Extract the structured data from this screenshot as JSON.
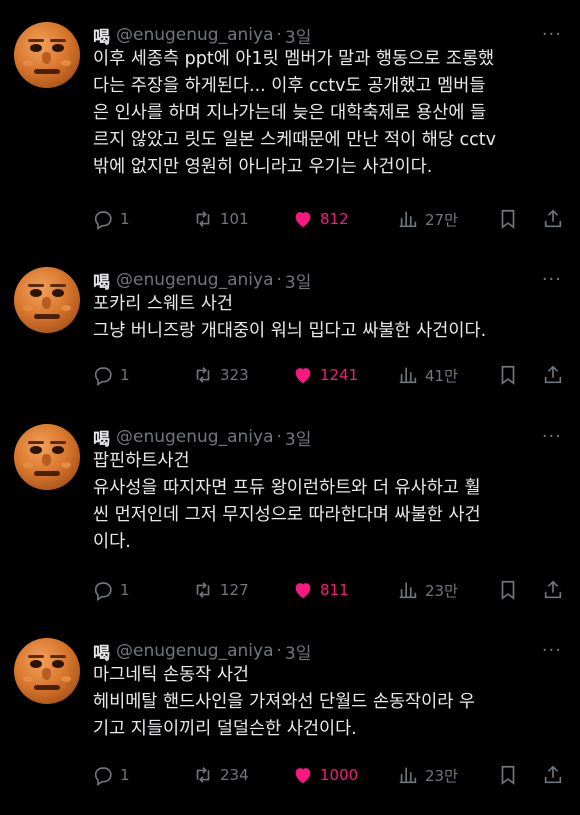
{
  "colors": {
    "background": "#000000",
    "text": "#e7e9ea",
    "muted": "#71767b",
    "like": "#f91880"
  },
  "icons": {
    "more": "more-icon",
    "reply": "reply-icon",
    "retweet": "retweet-icon",
    "like": "heart-filled-icon",
    "views": "views-icon",
    "bookmark": "bookmark-icon",
    "share": "share-icon"
  },
  "more_glyph": "···",
  "dot": "·",
  "tweets": [
    {
      "name": "喝",
      "handle": "@enugenug_aniya",
      "time": "3일",
      "lines": [
        "이후 세종측 ppt에 아1릿 멤버가 말과 행동으로 조롱했",
        "다는 주장을 하게된다... 이후 cctv도 공개했고 멤버들",
        "은 인사를 하며 지나가는데 늦은 대학축제로 용산에 들",
        "르지 않았고 릿도 일본 스케때문에 만난 적이 해당 cctv",
        "밖에 없지만 영원히 아니라고 우기는 사건이다."
      ],
      "replies": "1",
      "retweets": "101",
      "likes": "812",
      "views": "27만"
    },
    {
      "name": "喝",
      "handle": "@enugenug_aniya",
      "time": "3일",
      "lines": [
        "포카리 스웨트 사건",
        "그냥 버니즈랑 개대중이 워늬 밉다고 싸불한 사건이다."
      ],
      "replies": "1",
      "retweets": "323",
      "likes": "1241",
      "views": "41만"
    },
    {
      "name": "喝",
      "handle": "@enugenug_aniya",
      "time": "3일",
      "lines": [
        "팝핀하트사건",
        "유사성을 따지자면 프듀 왕이런하트와 더 유사하고 훨",
        "씬 먼저인데 그저 무지성으로 따라한다며 싸불한 사건",
        "이다."
      ],
      "replies": "1",
      "retweets": "127",
      "likes": "811",
      "views": "23만"
    },
    {
      "name": "喝",
      "handle": "@enugenug_aniya",
      "time": "3일",
      "lines": [
        "마그네틱 손동작 사건",
        "헤비메탈 핸드사인을 가져와선 단월드 손동작이라 우",
        "기고 지들이끼리 덜덜슨한 사건이다."
      ],
      "replies": "1",
      "retweets": "234",
      "likes": "1000",
      "views": "23만"
    }
  ]
}
